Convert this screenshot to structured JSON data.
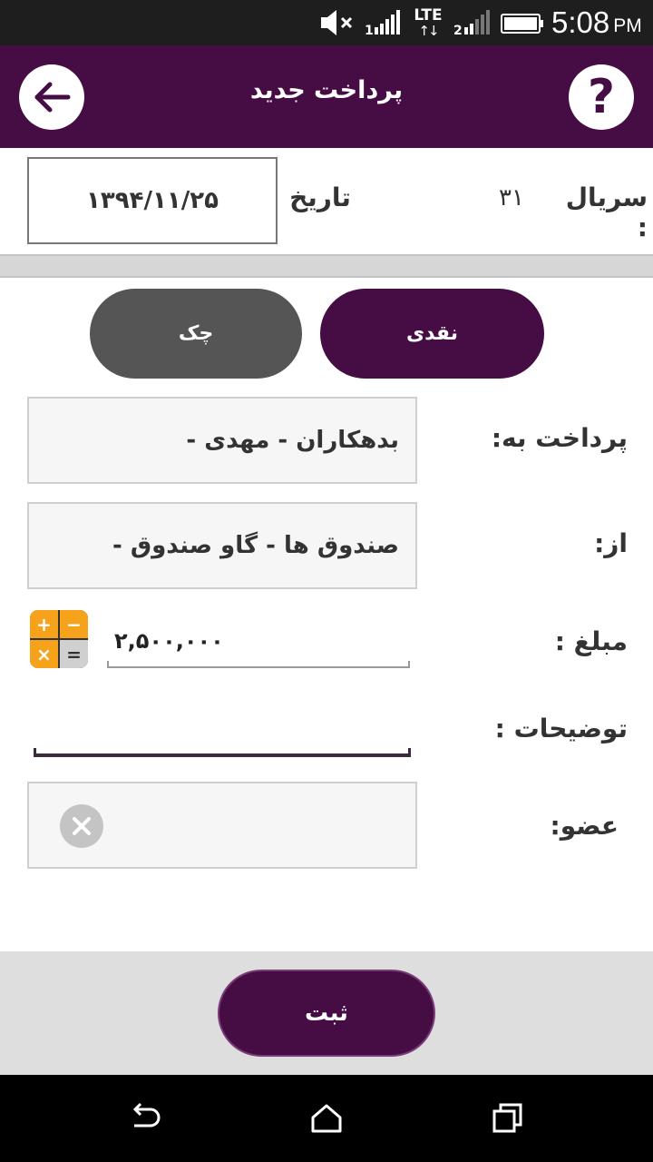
{
  "status_bar": {
    "time": "5:08",
    "ampm": "PM",
    "network": "LTE",
    "sim1_label": "1",
    "sim2_label": "2",
    "icons": [
      "mute-icon",
      "signal-sim1-icon",
      "lte-data-icon",
      "signal-sim2-icon",
      "battery-icon"
    ]
  },
  "app_bar": {
    "title": "پرداخت جدید",
    "back_icon": "arrow-left-icon",
    "help_icon": "question-mark-icon",
    "help_glyph": "?",
    "accent_color": "#460c44"
  },
  "header": {
    "serial_label": "سریال :",
    "serial_value": "۳۱",
    "date_label": "تاریخ",
    "date_value": "۱۳۹۴/۱۱/۲۵"
  },
  "payment_type": {
    "options": [
      {
        "label": "نقدی",
        "selected": true
      },
      {
        "label": "چک",
        "selected": false
      }
    ]
  },
  "form": {
    "pay_to_label": "پرداخت به:",
    "pay_to_value": "بدهکاران - مهدی -",
    "from_label": "از:",
    "from_value": "صندوق ها - گاو صندوق -",
    "amount_label": "مبلغ :",
    "amount_value": "۲,۵۰۰,۰۰۰",
    "calculator_icon": "calculator-icon",
    "calculator_keys": [
      "+",
      "−",
      "×",
      "="
    ],
    "description_label": "توضیحات :",
    "description_value": "",
    "member_label": "عضو:",
    "member_value": "",
    "clear_icon": "clear-icon"
  },
  "actions": {
    "submit_label": "ثبت"
  },
  "nav_bar": {
    "icons": [
      "nav-back-icon",
      "nav-home-icon",
      "nav-recent-apps-icon"
    ]
  }
}
